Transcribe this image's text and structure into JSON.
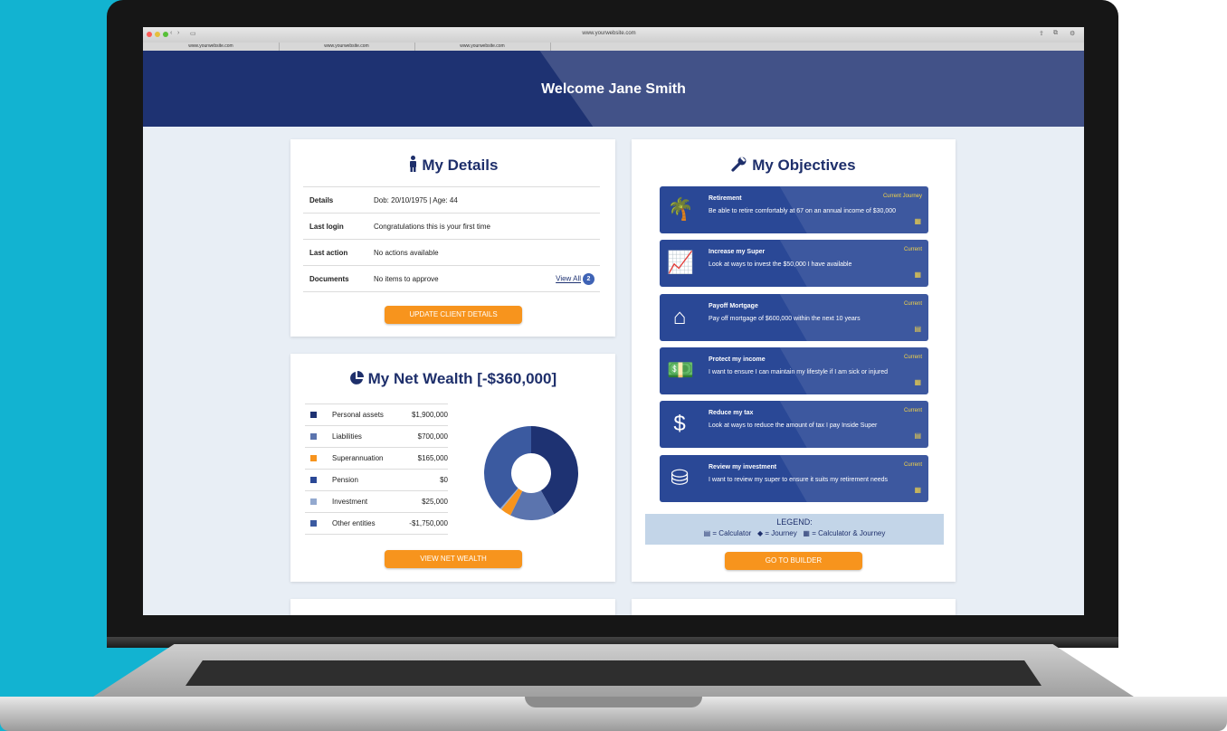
{
  "browser": {
    "address": "www.yourwebsite.com",
    "tabs": [
      "www.yourwebsite.com",
      "www.yourwebsite.com",
      "www.yourwebsite.com"
    ]
  },
  "header": {
    "welcome": "Welcome Jane Smith",
    "color": "#1e3272"
  },
  "my_details": {
    "title": "My Details",
    "icon": "person-icon",
    "rows": [
      {
        "label": "Details",
        "value": "Dob: 20/10/1975  |  Age: 44"
      },
      {
        "label": "Last login",
        "value": "Congratulations this is your first time"
      },
      {
        "label": "Last action",
        "value": "No actions available"
      },
      {
        "label": "Documents",
        "value": "No items to approve"
      }
    ],
    "view_all": "View All",
    "view_all_count": "2",
    "button": "UPDATE CLIENT DETAILS"
  },
  "net_wealth": {
    "title": "My Net Wealth [-$360,000]",
    "icon": "pie-chart-icon",
    "items": [
      {
        "name": "Personal assets",
        "amount": "$1,900,000",
        "color": "#1e3272"
      },
      {
        "name": "Liabilities",
        "amount": "$700,000",
        "color": "#5b74ae"
      },
      {
        "name": "Superannuation",
        "amount": "$165,000",
        "color": "#f7941d"
      },
      {
        "name": "Pension",
        "amount": "$0",
        "color": "#2a4896"
      },
      {
        "name": "Investment",
        "amount": "$25,000",
        "color": "#93a9cf"
      },
      {
        "name": "Other entities",
        "amount": "-$1,750,000",
        "color": "#3b5aa0"
      }
    ],
    "button": "VIEW NET WEALTH"
  },
  "objectives": {
    "title": "My Objectives",
    "icon": "wrench-icon",
    "items": [
      {
        "title": "Retirement",
        "desc": "Be able to retire comfortably at 67 on an annual income of $30,000",
        "tag": "Current Journey",
        "icon": "palm-tree-icon",
        "glyph": "🌴",
        "mode_icon": "calculator-journey-icon",
        "mode_glyph": "▦"
      },
      {
        "title": "Increase my Super",
        "desc": "Look at ways to invest the $50,000 I have available",
        "tag": "Current",
        "icon": "growth-chart-icon",
        "glyph": "📈",
        "mode_icon": "calculator-journey-icon",
        "mode_glyph": "▦"
      },
      {
        "title": "Payoff Mortgage",
        "desc": "Pay off mortgage of $600,000 within the next 10 years",
        "tag": "Current",
        "icon": "house-icon",
        "glyph": "⌂",
        "mode_icon": "calculator-icon",
        "mode_glyph": "▤"
      },
      {
        "title": "Protect my income",
        "desc": "I want to ensure I can maintain my lifestyle if I am sick or injured",
        "tag": "Current",
        "icon": "money-icon",
        "glyph": "💵",
        "mode_icon": "calculator-journey-icon",
        "mode_glyph": "▦"
      },
      {
        "title": "Reduce my tax",
        "desc": "Look at ways to reduce the amount of tax I pay Inside Super",
        "tag": "Current",
        "icon": "dollar-icon",
        "glyph": "$",
        "mode_icon": "calculator-icon",
        "mode_glyph": "▤"
      },
      {
        "title": "Review my investment",
        "desc": "I want to review my super to ensure it suits my retirement needs",
        "tag": "Current",
        "icon": "coins-icon",
        "glyph": "⛁",
        "mode_icon": "calculator-journey-icon",
        "mode_glyph": "▦"
      }
    ],
    "legend_title": "LEGEND:",
    "legend": [
      {
        "glyph": "▤",
        "text": "= Calculator",
        "icon": "calculator-icon"
      },
      {
        "glyph": "◆",
        "text": "= Journey",
        "icon": "journey-icon"
      },
      {
        "glyph": "▦",
        "text": "= Calculator & Journey",
        "icon": "calculator-journey-icon"
      }
    ],
    "button": "GO TO BUILDER"
  },
  "colors": {
    "accent": "#f7941d",
    "primary": "#1e3272",
    "background_left": "#12b3d1"
  }
}
